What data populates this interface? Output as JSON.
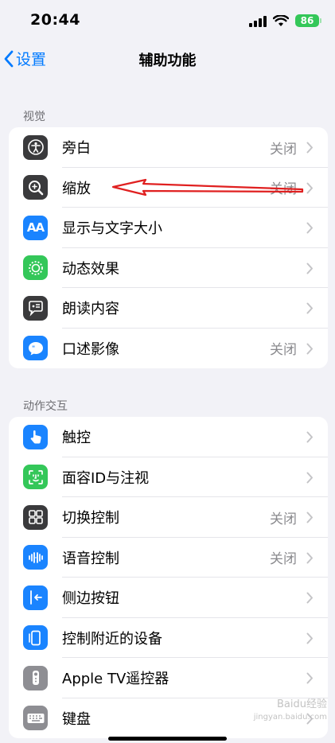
{
  "status_bar": {
    "time": "20:44",
    "battery": "86"
  },
  "nav": {
    "back_label": "设置",
    "title": "辅助功能"
  },
  "sections": [
    {
      "header": "视觉",
      "items": [
        {
          "label": "旁白",
          "value": "关闭",
          "icon": "voiceover-icon",
          "color": "#3a3a3c"
        },
        {
          "label": "缩放",
          "value": "关闭",
          "icon": "zoom-icon",
          "color": "#3a3a3c"
        },
        {
          "label": "显示与文字大小",
          "value": "",
          "icon": "text-size-icon",
          "color": "#1a84ff"
        },
        {
          "label": "动态效果",
          "value": "",
          "icon": "motion-icon",
          "color": "#34c759"
        },
        {
          "label": "朗读内容",
          "value": "",
          "icon": "spoken-content-icon",
          "color": "#3a3a3c"
        },
        {
          "label": "口述影像",
          "value": "关闭",
          "icon": "audio-description-icon",
          "color": "#1a84ff"
        }
      ]
    },
    {
      "header": "动作交互",
      "items": [
        {
          "label": "触控",
          "value": "",
          "icon": "touch-icon",
          "color": "#1a84ff"
        },
        {
          "label": "面容ID与注视",
          "value": "",
          "icon": "face-id-icon",
          "color": "#34c759"
        },
        {
          "label": "切换控制",
          "value": "关闭",
          "icon": "switch-control-icon",
          "color": "#3a3a3c"
        },
        {
          "label": "语音控制",
          "value": "关闭",
          "icon": "voice-control-icon",
          "color": "#1a84ff"
        },
        {
          "label": "侧边按钮",
          "value": "",
          "icon": "side-button-icon",
          "color": "#1a84ff"
        },
        {
          "label": "控制附近的设备",
          "value": "",
          "icon": "nearby-devices-icon",
          "color": "#1a84ff"
        },
        {
          "label": "Apple TV遥控器",
          "value": "",
          "icon": "apple-tv-remote-icon",
          "color": "#8e8e93"
        },
        {
          "label": "键盘",
          "value": "",
          "icon": "keyboard-icon",
          "color": "#8e8e93"
        }
      ]
    }
  ],
  "watermark": {
    "line1": "Baidu经验",
    "line2": "jingyan.baidu.com"
  }
}
